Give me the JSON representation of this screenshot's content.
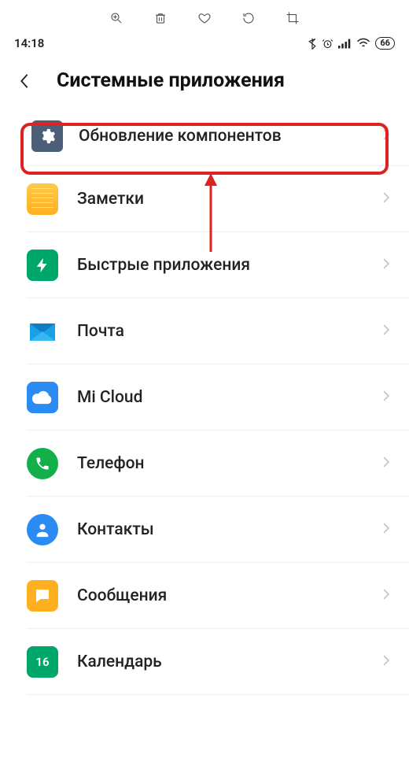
{
  "status": {
    "time": "14:18",
    "battery": "66"
  },
  "header": {
    "title": "Системные приложения"
  },
  "apps": [
    {
      "label": "Обновление компонентов"
    },
    {
      "label": "Заметки"
    },
    {
      "label": "Быстрые приложения"
    },
    {
      "label": "Почта"
    },
    {
      "label": "Mi Cloud"
    },
    {
      "label": "Телефон"
    },
    {
      "label": "Контакты"
    },
    {
      "label": "Сообщения"
    },
    {
      "label": "Календарь",
      "badge": "16"
    }
  ]
}
